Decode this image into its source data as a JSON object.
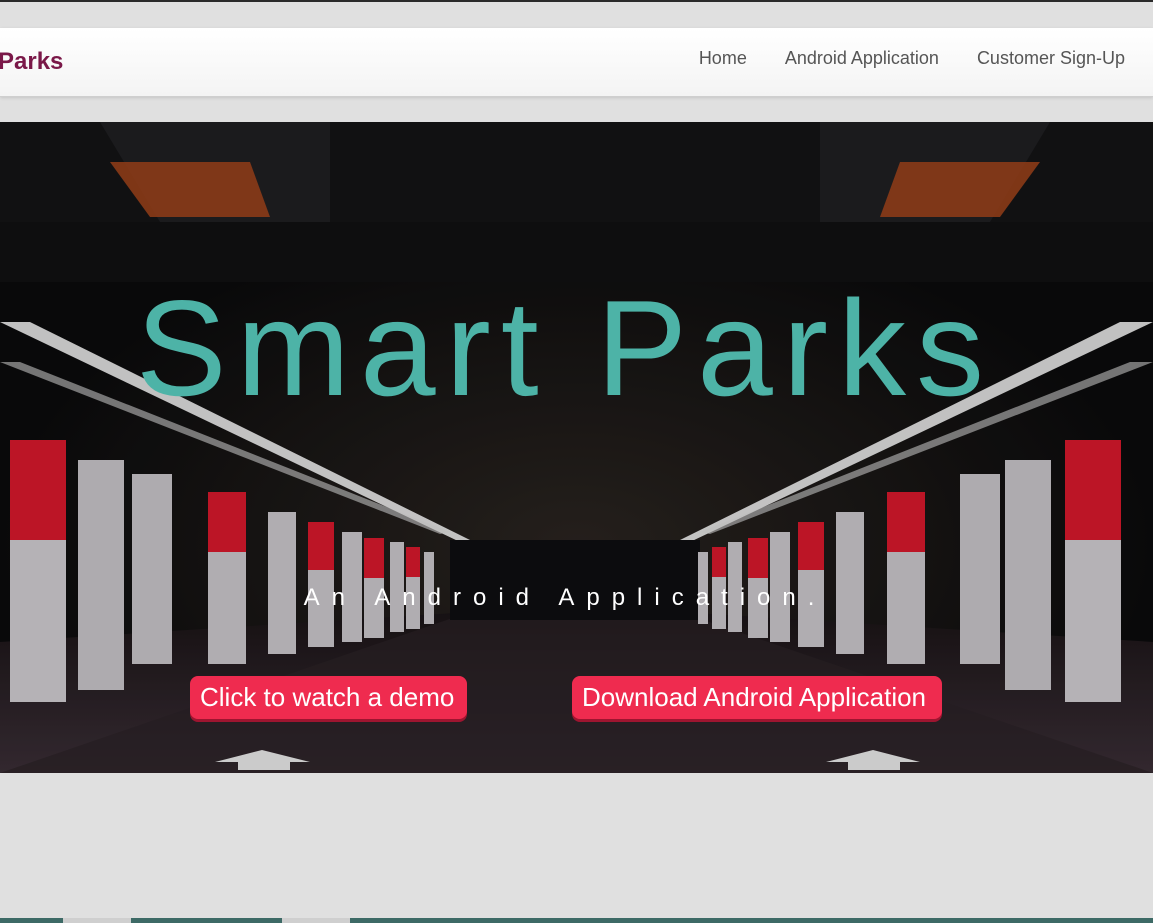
{
  "navbar": {
    "brand": "Parks",
    "links": [
      {
        "label": "Home"
      },
      {
        "label": "Android Application"
      },
      {
        "label": "Customer Sign-Up"
      }
    ]
  },
  "hero": {
    "title": "Smart Parks",
    "subtitle": "An Android Application.",
    "demo_button": "Click to watch a demo",
    "download_button": "Download Android Application"
  },
  "colors": {
    "brand": "#7a1848",
    "title": "#4db3a7",
    "button": "#ef2b4f"
  },
  "icons": {
    "decorative": "parking-arrow-icon"
  }
}
